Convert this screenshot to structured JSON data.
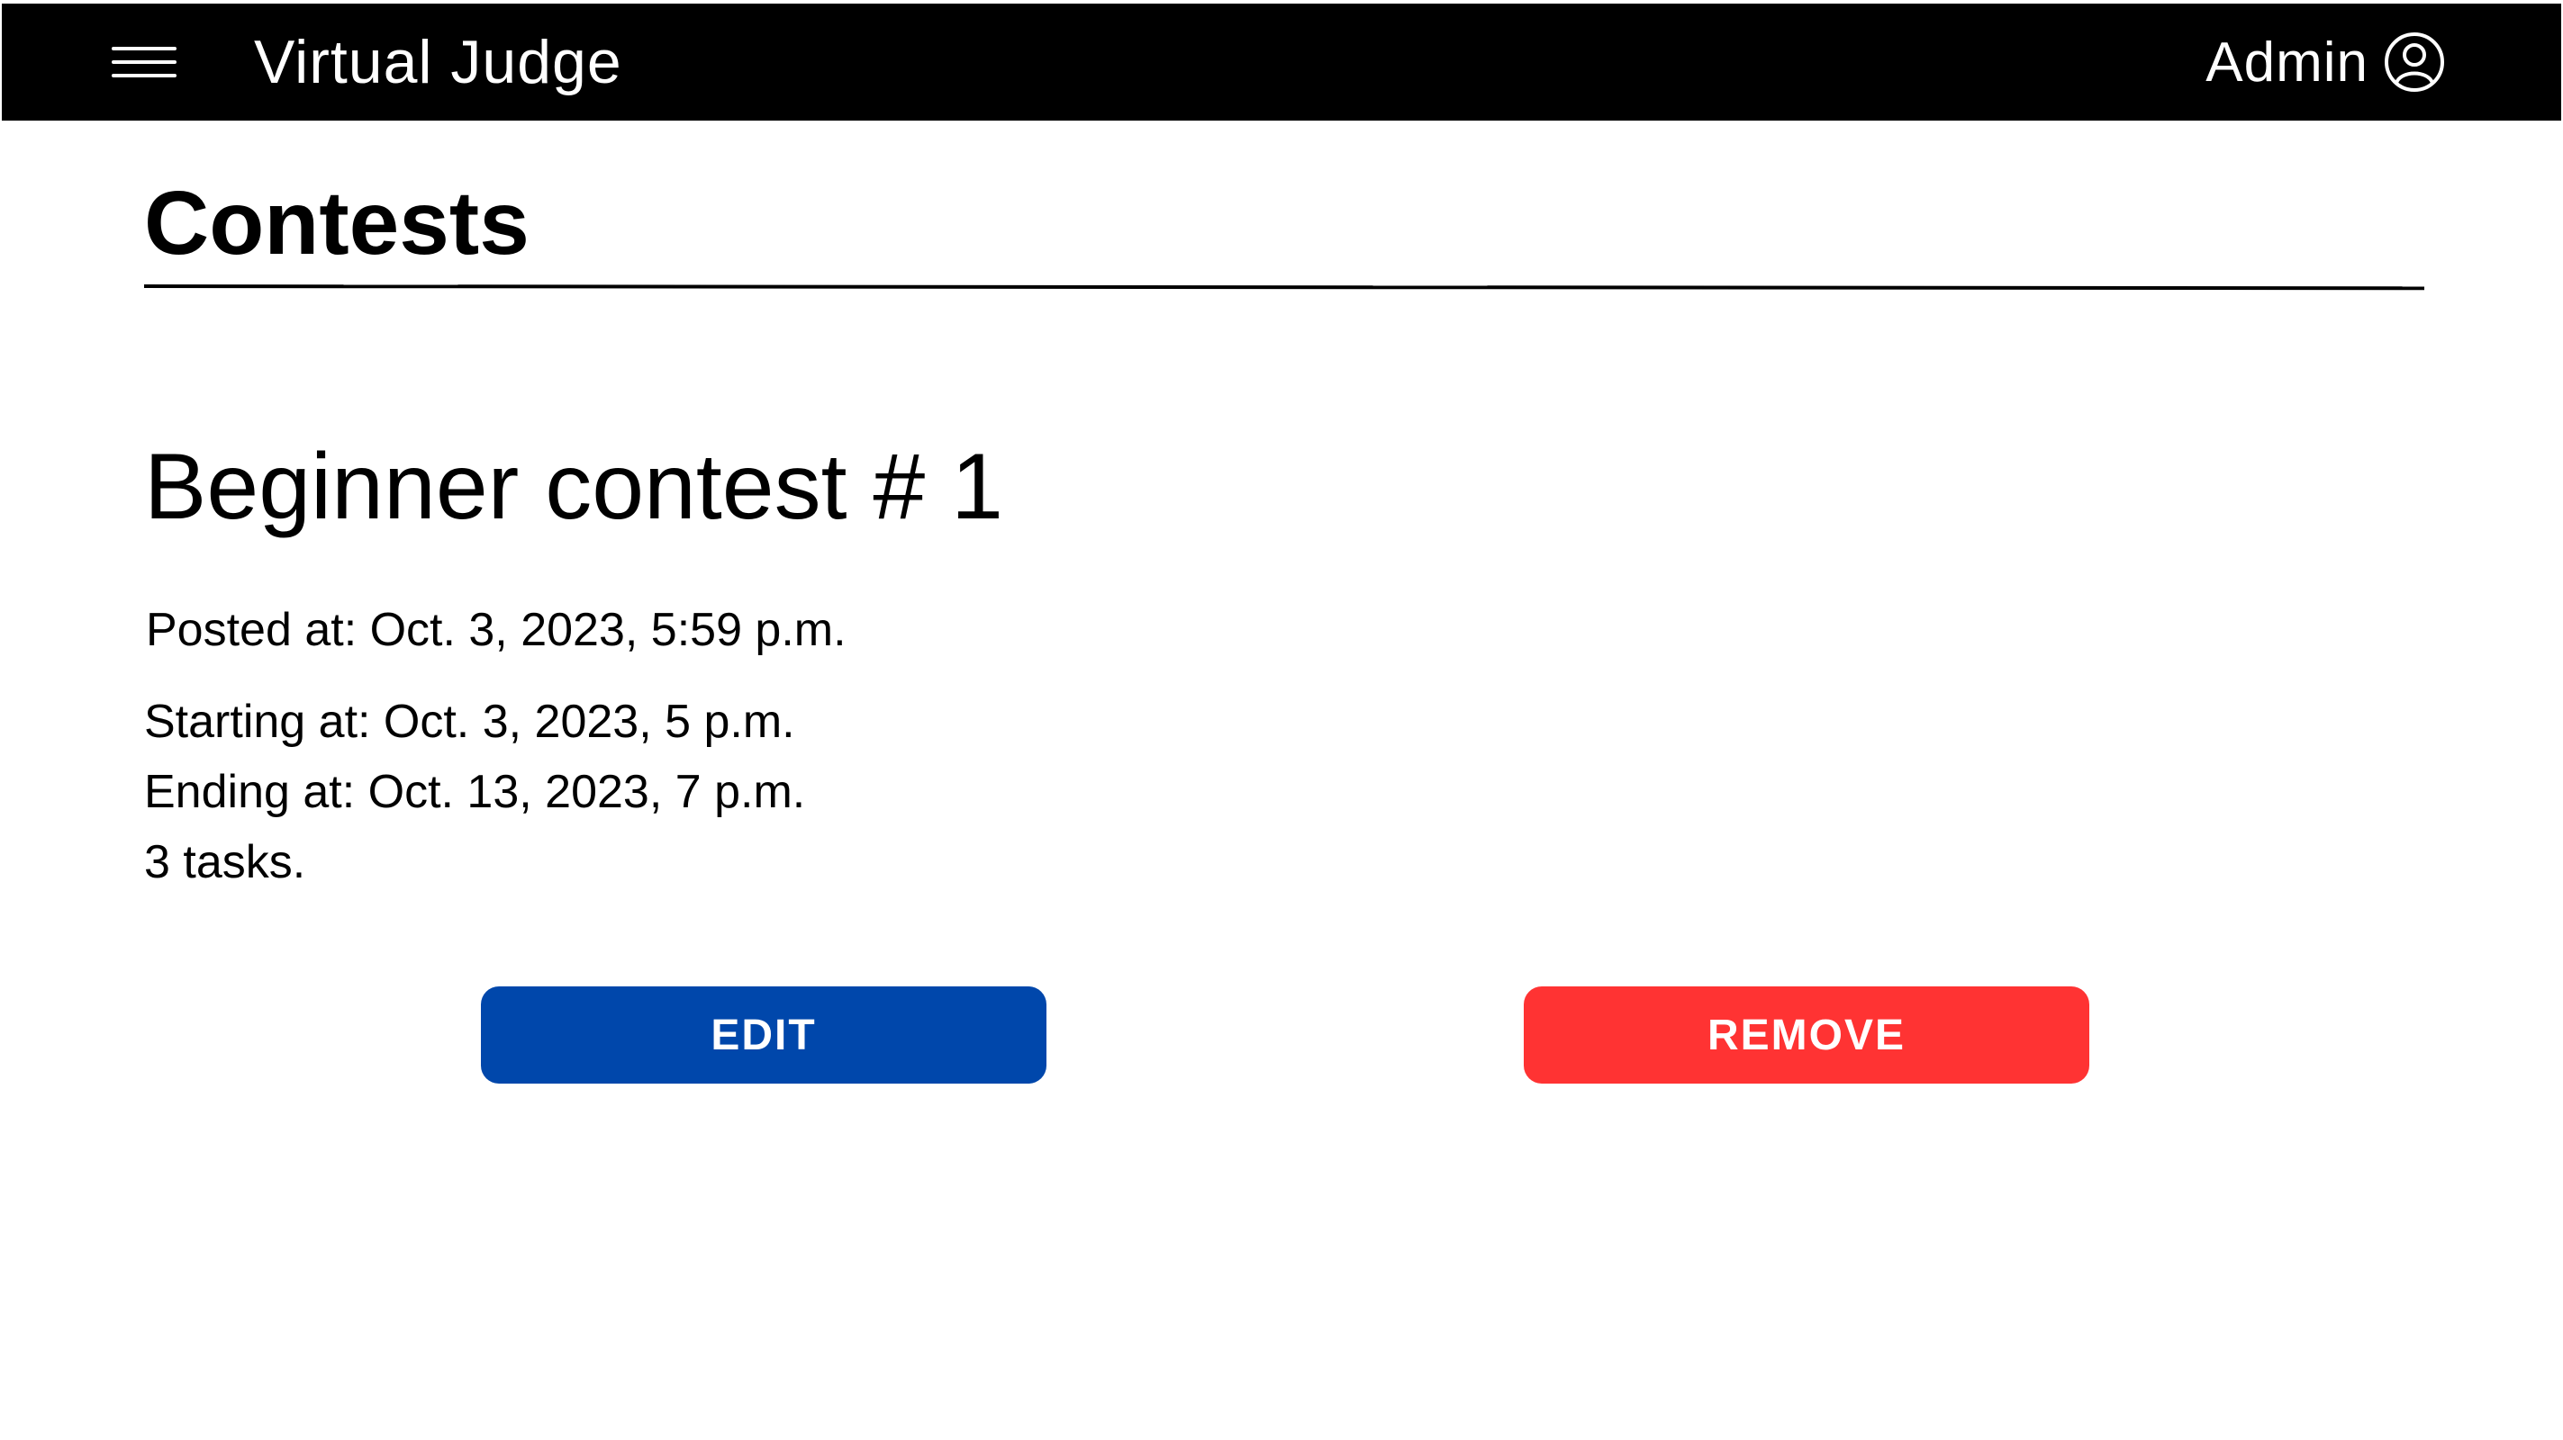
{
  "header": {
    "menu_icon": "hamburger-menu-icon",
    "app_title": "Virtual Judge",
    "user_name": "Admin",
    "user_icon": "user-account-icon",
    "background_color": "#000000"
  },
  "page": {
    "title": "Contests"
  },
  "contest": {
    "name": "Beginner contest # 1",
    "posted_at": "Posted at: Oct. 3, 2023, 5:59 p.m.",
    "starting_at": "Starting at: Oct. 3, 2023, 5 p.m.",
    "ending_at": "Ending at: Oct. 13, 2023, 7 p.m.",
    "tasks": "3 tasks."
  },
  "actions": {
    "edit_label": "EDIT",
    "edit_color": "#0047ab",
    "remove_label": "REMOVE",
    "remove_color": "#ff3333"
  }
}
